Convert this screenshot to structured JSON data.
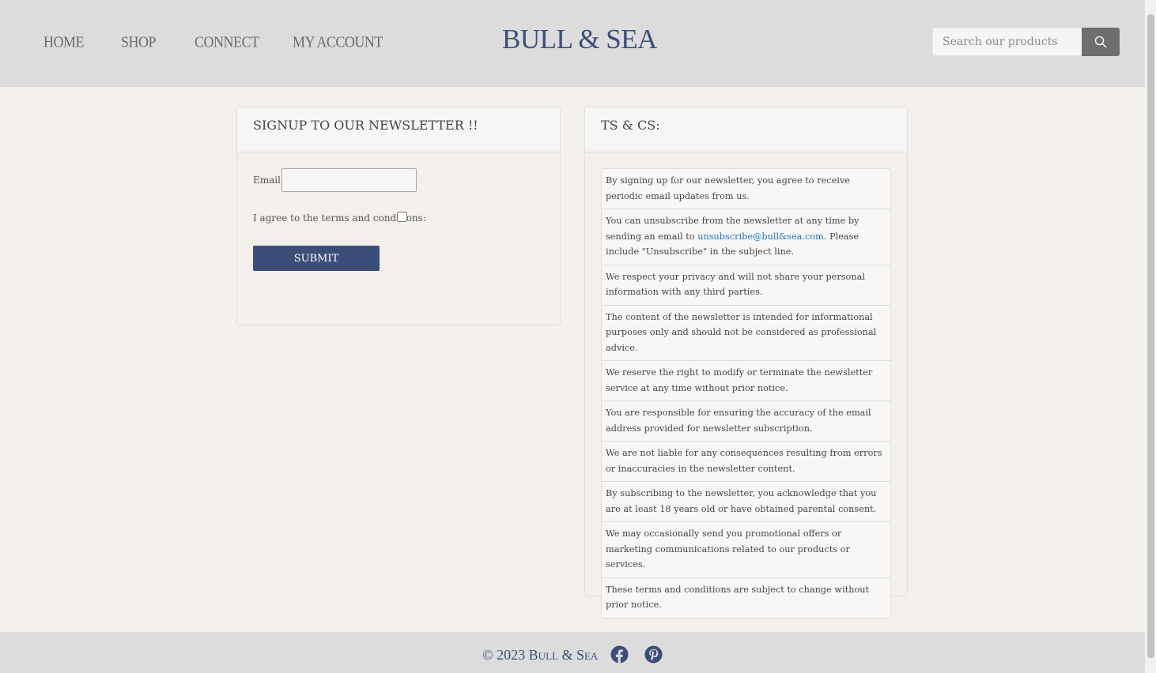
{
  "nav": {
    "home": "HOME",
    "shop": "SHOP",
    "connect": "CONNECT",
    "account": "MY ACCOUNT"
  },
  "logo": "BULL & SEA",
  "search": {
    "placeholder": "Search our products"
  },
  "newsletter": {
    "title": "SIGNUP TO OUR NEWSLETTER !!",
    "email_label": "Email:",
    "email_value": "",
    "agree_label": "I agree to the terms and conditions:",
    "submit": "SUBMIT"
  },
  "terms": {
    "title": "TS & CS:",
    "items": [
      "By signing up for our newsletter, you agree to receive periodic email updates from us.",
      "",
      "We respect your privacy and will not share your personal information with any third parties.",
      "The content of the newsletter is intended for informational purposes only and should not be considered as professional advice.",
      "We reserve the right to modify or terminate the newsletter service at any time without prior notice.",
      "You are responsible for ensuring the accuracy of the email address provided for newsletter subscription.",
      "We are not liable for any consequences resulting from errors or inaccuracies in the newsletter content.",
      "By subscribing to the newsletter, you acknowledge that you are at least 18 years old or have obtained parental consent.",
      "We may occasionally send you promotional offers or marketing communications related to our products or services.",
      "These terms and conditions are subject to change without prior notice."
    ],
    "unsub_pre": "You can unsubscribe from the newsletter at any time by sending an email to ",
    "unsub_email": "unsubscribe@bull&sea.com",
    "unsub_post": ". Please include \"Unsubscribe\" in the subject line."
  },
  "footer": {
    "copyright": "© 2023 Bull & Sea"
  },
  "colors": {
    "brand": "#3a4e78",
    "link": "#1a73c8"
  }
}
